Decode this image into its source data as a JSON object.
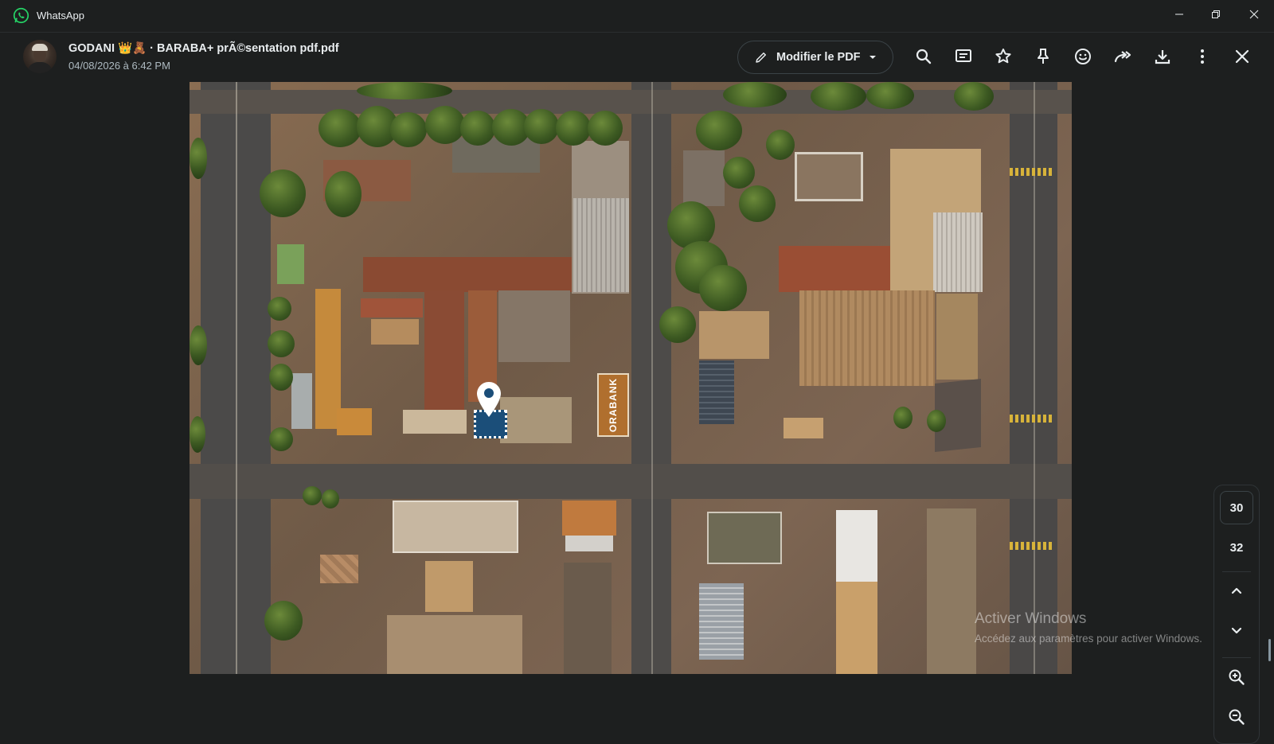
{
  "app": {
    "title": "WhatsApp",
    "brand_color": "#25d366"
  },
  "window_controls": [
    "minimize-icon",
    "restore-icon",
    "close-icon"
  ],
  "header": {
    "chat_title": "GODANI 👑🧸 · BARABA+ prÃ©sentation pdf.pdf",
    "date": "04/08/2026 à 6:42 PM",
    "edit_pdf_label": "Modifier le PDF",
    "icons": [
      "search-icon",
      "message-icon",
      "star-icon",
      "pin-icon",
      "emoji-icon",
      "forward-icon",
      "download-icon",
      "more-icon",
      "close-icon"
    ]
  },
  "document": {
    "map_label": "ORABANK"
  },
  "pager": {
    "pages": [
      "30",
      "32"
    ],
    "current_page": "30",
    "controls": [
      "chevron-up-icon",
      "chevron-down-icon",
      "zoom-in-icon",
      "zoom-out-icon"
    ]
  },
  "watermark": {
    "line1": "Activer Windows",
    "line2": "Accédez aux paramètres pour activer Windows."
  }
}
